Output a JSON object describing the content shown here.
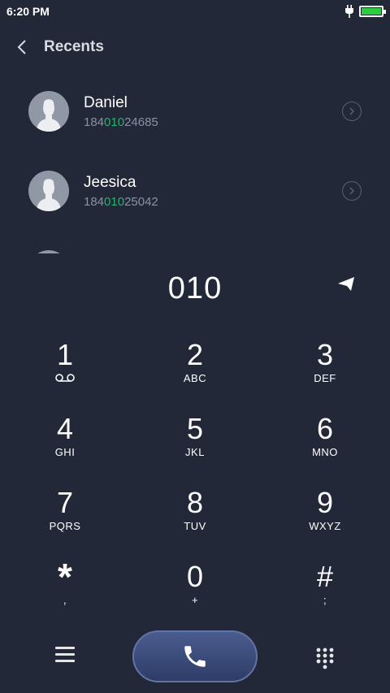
{
  "status_bar": {
    "time": "6:20 PM"
  },
  "header": {
    "title": "Recents"
  },
  "recents": [
    {
      "name": "Daniel",
      "number_prefix": "184",
      "number_match": "010",
      "number_suffix": "24685"
    },
    {
      "name": "Jeesica",
      "number_prefix": "184",
      "number_match": "010",
      "number_suffix": "25042"
    }
  ],
  "dialer": {
    "entered": "010"
  },
  "keypad": {
    "keys": [
      {
        "digit": "1",
        "letters": ""
      },
      {
        "digit": "2",
        "letters": "ABC"
      },
      {
        "digit": "3",
        "letters": "DEF"
      },
      {
        "digit": "4",
        "letters": "GHI"
      },
      {
        "digit": "5",
        "letters": "JKL"
      },
      {
        "digit": "6",
        "letters": "MNO"
      },
      {
        "digit": "7",
        "letters": "PQRS"
      },
      {
        "digit": "8",
        "letters": "TUV"
      },
      {
        "digit": "9",
        "letters": "WXYZ"
      },
      {
        "digit": "*",
        "letters": ","
      },
      {
        "digit": "0",
        "letters": "+"
      },
      {
        "digit": "#",
        "letters": ";"
      }
    ]
  },
  "colors": {
    "background": "#232839",
    "highlight": "#27b36a",
    "battery": "#2ecc40",
    "call_button": "#3a4a7a"
  },
  "icons": {
    "back": "chevron-left-icon",
    "detail": "chevron-right-circle-icon",
    "send": "send-arrow-icon",
    "voicemail": "voicemail-icon",
    "menu": "hamburger-menu-icon",
    "call": "phone-icon",
    "dialpad": "dialpad-grid-icon",
    "charging": "charging-plug-icon",
    "battery": "battery-icon"
  }
}
